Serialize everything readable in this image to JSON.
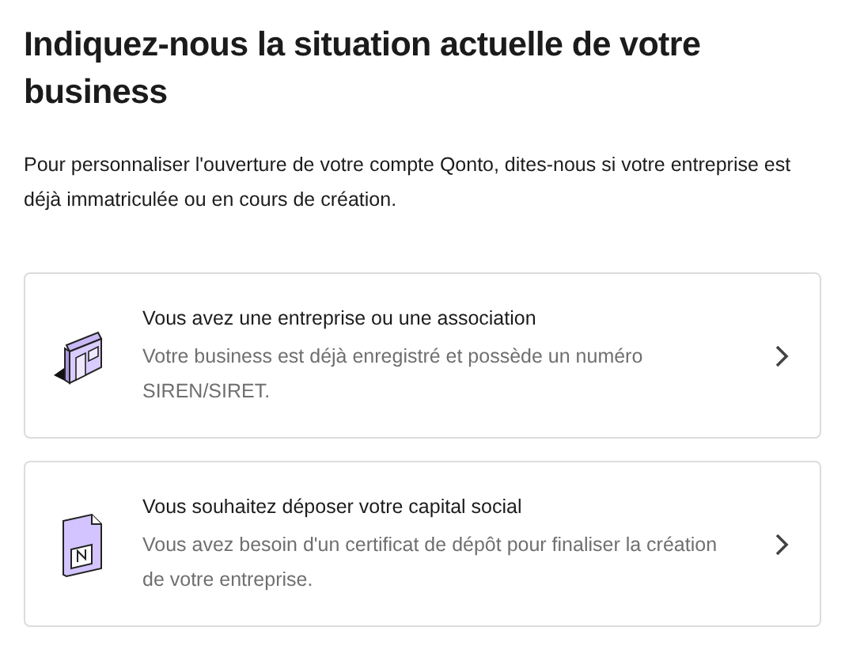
{
  "title": "Indiquez-nous la situation actuelle de votre business",
  "intro": "Pour personnaliser l'ouverture de votre compte Qonto, dites-nous si votre entreprise est déjà immatriculée ou en cours de création.",
  "options": [
    {
      "kind": "shop",
      "title": "Vous avez une entreprise ou une association",
      "description": "Votre business est déjà enregistré et possède un numéro SIREN/SIRET."
    },
    {
      "kind": "certificate",
      "title": "Vous souhaitez déposer votre capital social",
      "description": "Vous avez besoin d'un certificat de dépôt pour finaliser la création de votre entreprise."
    }
  ]
}
